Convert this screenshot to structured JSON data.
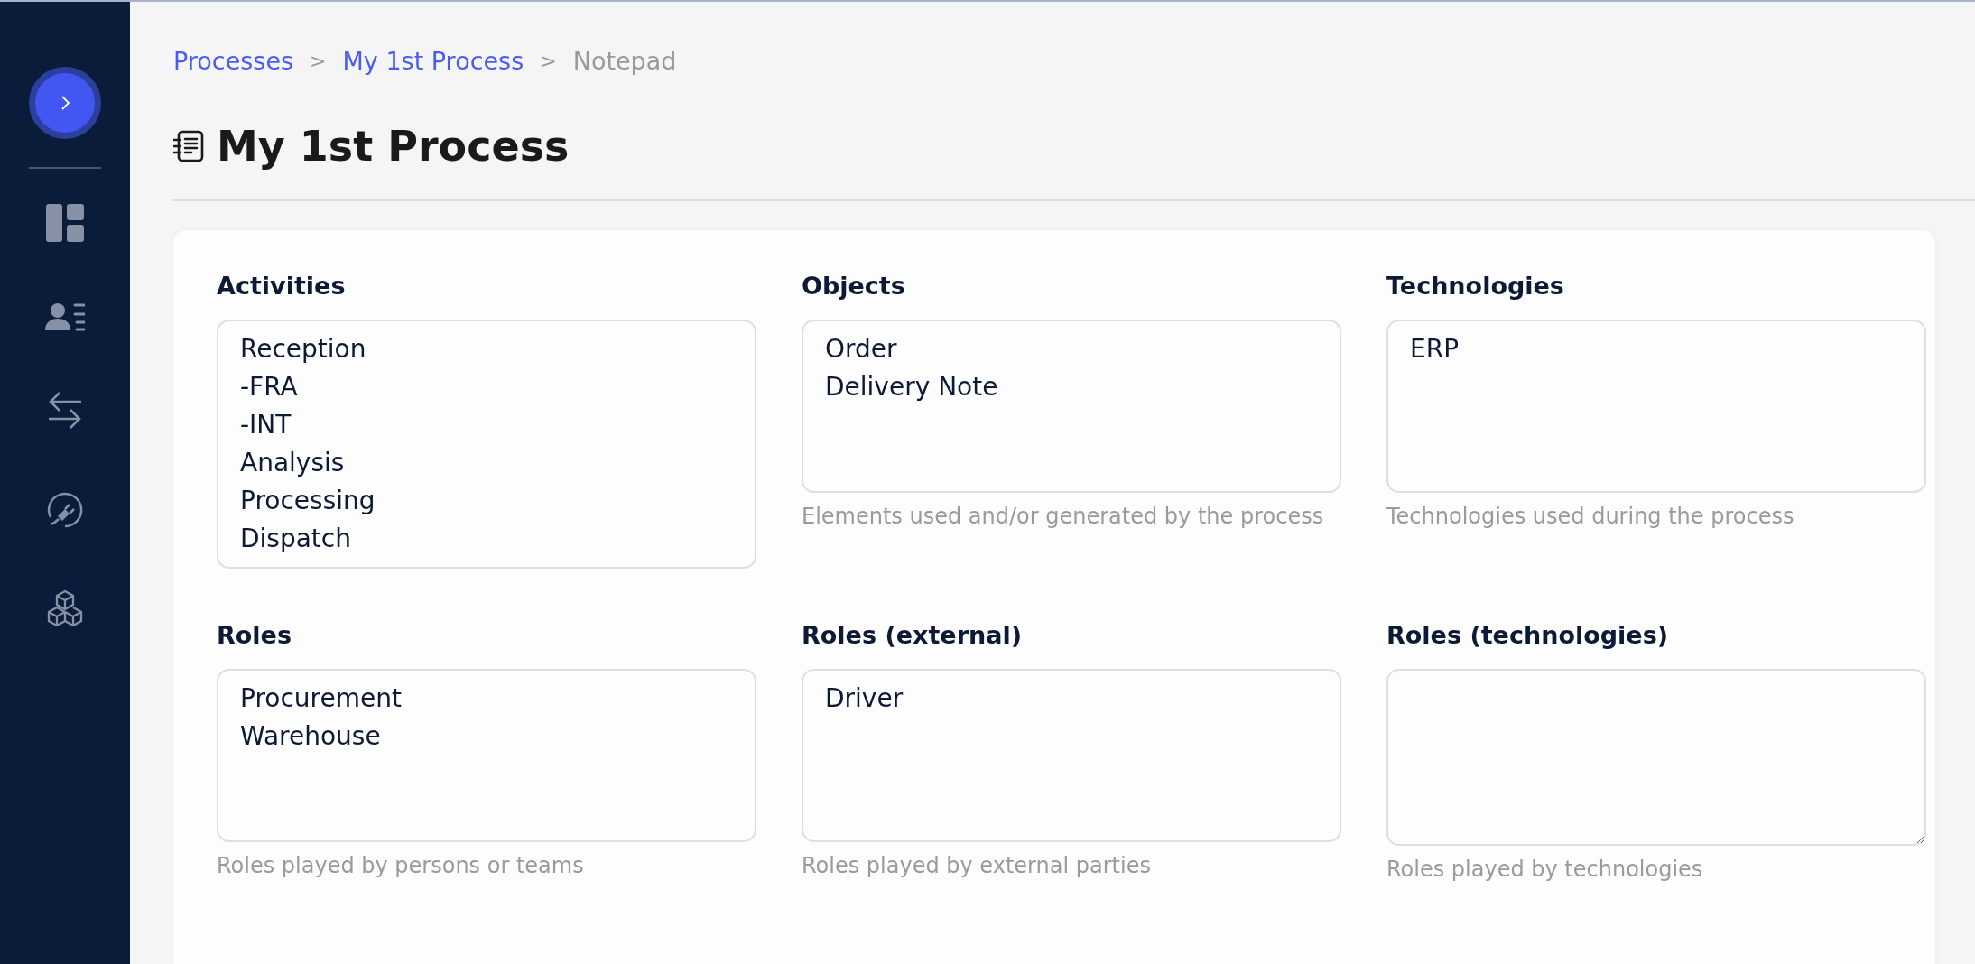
{
  "breadcrumbs": [
    {
      "label": "Processes",
      "link": true
    },
    {
      "label": "My 1st Process",
      "link": true
    },
    {
      "label": "Notepad",
      "link": false
    }
  ],
  "breadcrumb_separator": ">",
  "title": "My 1st Process",
  "fields": [
    {
      "label": "Activities",
      "lines": [
        "Reception",
        "-FRA",
        "-INT",
        "Analysis",
        "Processing",
        "Dispatch"
      ]
    },
    {
      "label": "Objects",
      "lines": [
        "Order",
        "Delivery Note"
      ],
      "help": "Elements used and/or generated by the process"
    },
    {
      "label": "Technologies",
      "lines": [
        "ERP"
      ],
      "help": "Technologies used during the process"
    },
    {
      "label": "Roles",
      "lines": [
        "Procurement",
        "Warehouse"
      ],
      "help": "Roles played by persons or teams"
    },
    {
      "label": "Roles (external)",
      "lines": [
        "Driver"
      ],
      "help": "Roles played by external parties"
    },
    {
      "label": "Roles (technologies)",
      "help": "Roles played by technologies"
    }
  ]
}
